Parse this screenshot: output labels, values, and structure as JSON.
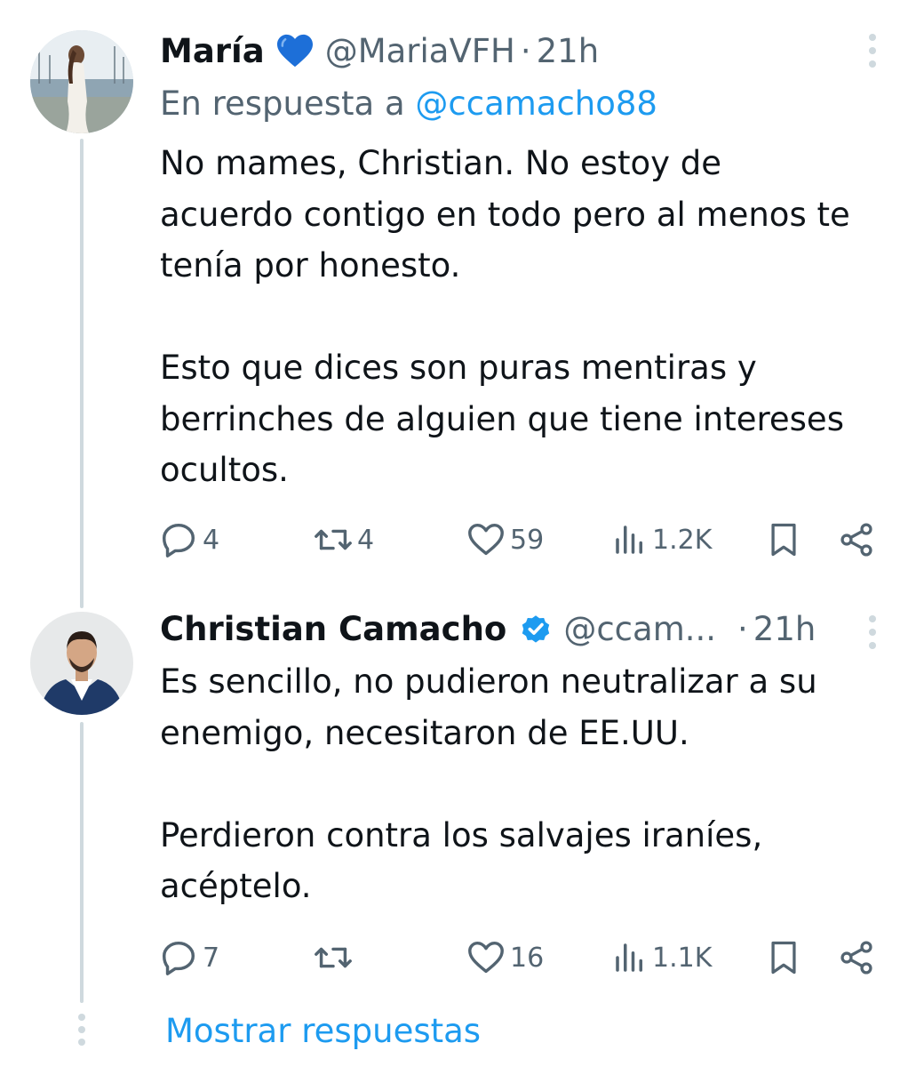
{
  "tweets": [
    {
      "name": "María",
      "handle": "@MariaVFH",
      "dot": "·",
      "time": "21h",
      "reply_prefix": "En respuesta a",
      "reply_mention": "@ccamacho88",
      "paragraphs": [
        [
          "No mames, Christian. No estoy de",
          "acuerdo contigo en todo pero al menos te",
          "tenía por honesto."
        ],
        [
          "Esto que dices son puras mentiras y",
          "berrinches de alguien que tiene intereses",
          "ocultos."
        ]
      ],
      "replies": "4",
      "reposts": "4",
      "likes": "59",
      "views": "1.2K"
    },
    {
      "name": "Christian Camacho",
      "handle": "@ccam...",
      "dot": "·",
      "time": "21h",
      "paragraphs": [
        [
          "Es sencillo, no pudieron neutralizar a su",
          "enemigo, necesitaron de EE.UU."
        ],
        [
          "Perdieron contra los salvajes iraníes,",
          "acéptelo."
        ]
      ],
      "replies": "7",
      "reposts": "",
      "likes": "16",
      "views": "1.1K"
    }
  ],
  "show_replies": "Mostrar respuestas",
  "colors": {
    "text": "#0f1419",
    "muted": "#536471",
    "accent": "#1d9bf0",
    "line": "#cfd9de"
  },
  "icons": [
    "reply-icon",
    "repost-icon",
    "like-icon",
    "views-icon",
    "bookmark-icon",
    "share-icon",
    "more-icon",
    "blue-heart-icon",
    "verified-badge-icon"
  ]
}
